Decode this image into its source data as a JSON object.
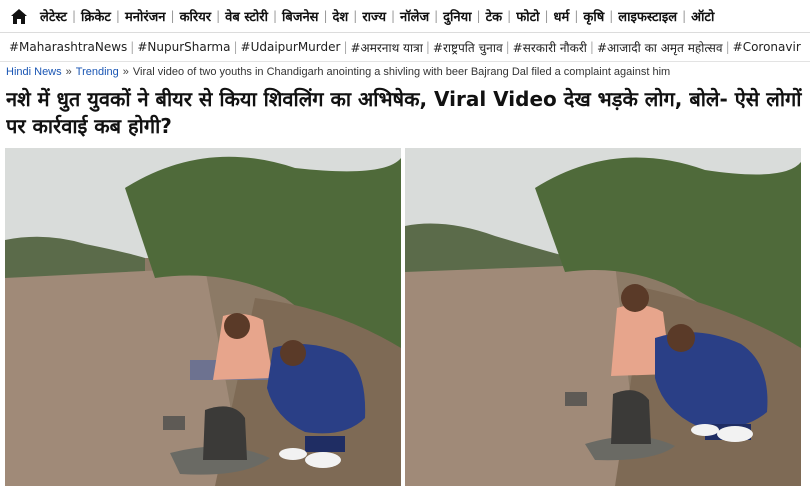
{
  "nav": {
    "items": [
      "लेटेस्ट",
      "क्रिकेट",
      "मनोरंजन",
      "करियर",
      "वेब स्टोरी",
      "बिजनेस",
      "देश",
      "राज्य",
      "नॉलेज",
      "दुनिया",
      "टेक",
      "फोटो",
      "धर्म",
      "कृषि",
      "लाइफस्टाइल",
      "ऑटो"
    ]
  },
  "tags": [
    "#MaharashtraNews",
    "#NupurSharma",
    "#UdaipurMurder",
    "#अमरनाथ यात्रा",
    "#राष्ट्रपति चुनाव",
    "#सरकारी नौकरी",
    "#आजादी का अमृत महोत्सव",
    "#Coronavir"
  ],
  "breadcrumb": {
    "home": "Hindi News",
    "section": "Trending",
    "current": "Viral video of two youths in Chandigarh anointing a shivling with beer Bajrang Dal filed a complaint against him"
  },
  "headline": "नशे में धुत युवकों ने बीयर से किया शिवलिंग का अभिषेक, Viral Video देख भड़के लोग, बोले- ऐसे लोगों पर कार्रवाई कब होगी?",
  "colors": {
    "link": "#1a56b4",
    "water": "#a08a78",
    "sky": "#d9dcda"
  }
}
